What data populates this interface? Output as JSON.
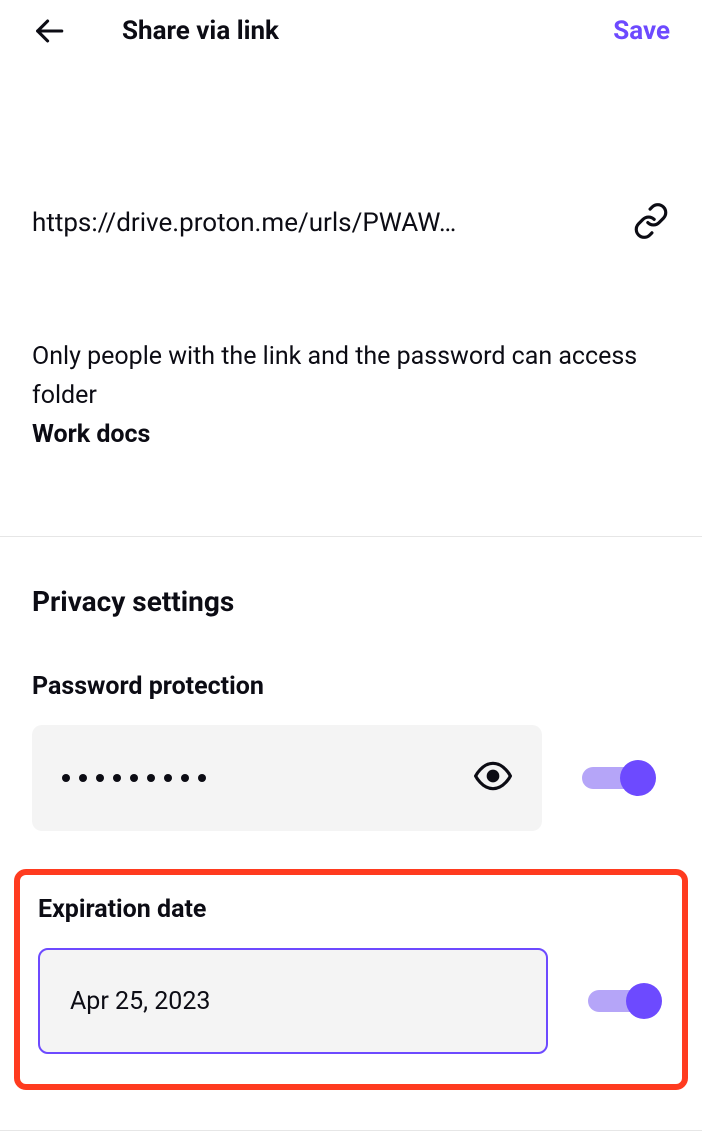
{
  "header": {
    "title": "Share via link",
    "save_label": "Save"
  },
  "link": {
    "url": "https://drive.proton.me/urls/PWAW…",
    "description": "Only people with the link and the password can access folder",
    "folder_name": "Work docs"
  },
  "privacy": {
    "section_title": "Privacy settings",
    "password_protection": {
      "label": "Password protection",
      "masked_count": 9,
      "toggle_on": true
    },
    "expiration": {
      "label": "Expiration date",
      "value": "Apr 25, 2023",
      "toggle_on": true
    }
  },
  "colors": {
    "accent": "#6d4aff",
    "accent_light": "#b5a5f8",
    "highlight": "#ff3b1f"
  }
}
